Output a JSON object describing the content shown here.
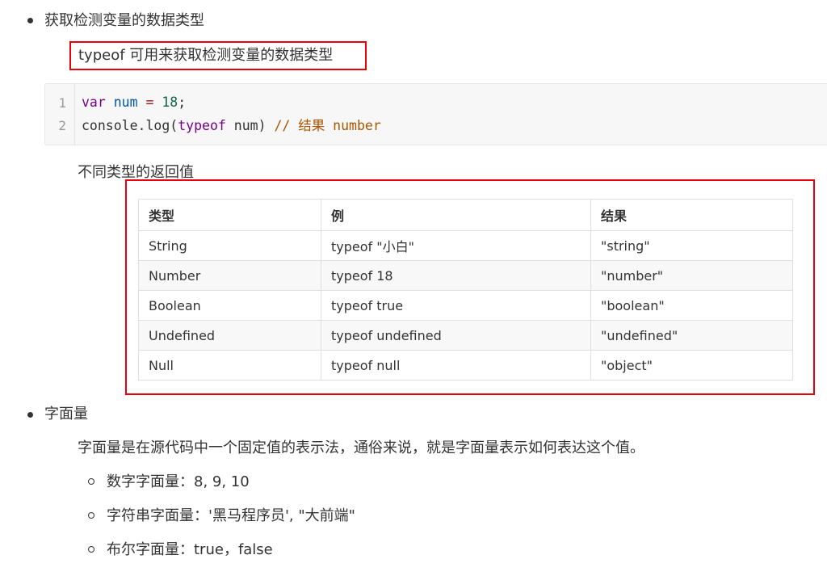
{
  "section_typeof": {
    "title": "获取检测变量的数据类型",
    "highlight": "typeof 可用来获取检测变量的数据类型",
    "code": [
      {
        "line_no": "1",
        "tokens": [
          {
            "t": "var",
            "c": "kw"
          },
          {
            "t": " ",
            "c": ""
          },
          {
            "t": "num",
            "c": "var"
          },
          {
            "t": " = ",
            "c": "op"
          },
          {
            "t": "18",
            "c": "num"
          },
          {
            "t": ";",
            "c": ""
          }
        ]
      },
      {
        "line_no": "2",
        "tokens": [
          {
            "t": "console.log(",
            "c": ""
          },
          {
            "t": "typeof",
            "c": "kw"
          },
          {
            "t": " num) ",
            "c": ""
          },
          {
            "t": "// 结果 number",
            "c": "comment"
          }
        ]
      }
    ],
    "table_caption": "不同类型的返回值",
    "table": {
      "headers": [
        "类型",
        "例",
        "结果"
      ],
      "rows": [
        [
          "String",
          "typeof \"小白\"",
          "\"string\""
        ],
        [
          "Number",
          "typeof 18",
          "\"number\""
        ],
        [
          "Boolean",
          "typeof true",
          "\"boolean\""
        ],
        [
          "Undefined",
          "typeof undefined",
          "\"undefined\""
        ],
        [
          "Null",
          "typeof null",
          "\"object\""
        ]
      ]
    }
  },
  "section_literal": {
    "title": "字面量",
    "desc": "字面量是在源代码中一个固定值的表示法，通俗来说，就是字面量表示如何表达这个值。",
    "items": [
      "数字字面量：8, 9, 10",
      "字符串字面量：'黑马程序员', \"大前端\"",
      "布尔字面量：true，false"
    ]
  },
  "colors": {
    "highlight_border": "#e8000a",
    "code_bg": "#f7f7f7"
  }
}
